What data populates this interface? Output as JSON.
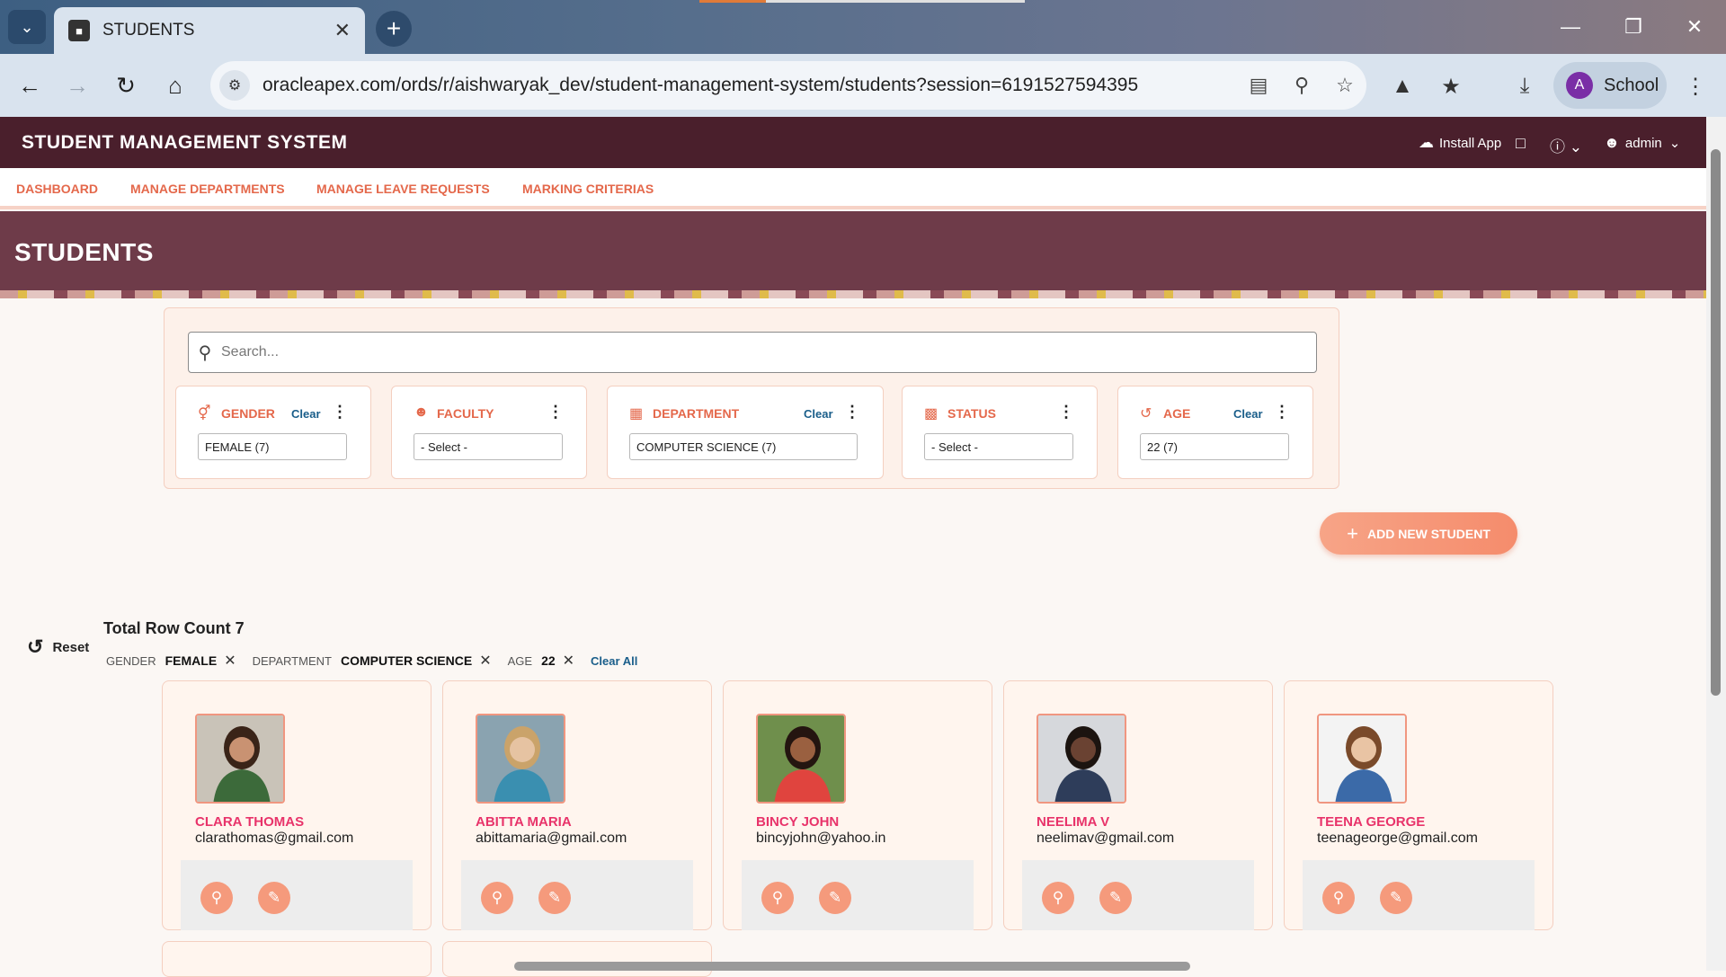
{
  "browser": {
    "tab_title": "STUDENTS",
    "url": "oracleapex.com/ords/r/aishwaryak_dev/student-management-system/students?session=6191527594395",
    "profile_initial": "A",
    "profile_name": "School"
  },
  "app": {
    "name": "STUDENT MANAGEMENT SYSTEM",
    "install_label": "Install App",
    "user_label": "admin"
  },
  "menu": {
    "items": [
      {
        "label": "DASHBOARD"
      },
      {
        "label": "MANAGE DEPARTMENTS"
      },
      {
        "label": "MANAGE LEAVE REQUESTS"
      },
      {
        "label": "MARKING CRITERIAS"
      }
    ]
  },
  "page": {
    "title": "STUDENTS"
  },
  "search": {
    "placeholder": "Search..."
  },
  "facets": [
    {
      "label": "GENDER",
      "clear": "Clear",
      "value": "FEMALE (7)"
    },
    {
      "label": "FACULTY",
      "clear": "",
      "value": "- Select -"
    },
    {
      "label": "DEPARTMENT",
      "clear": "Clear",
      "value": "COMPUTER SCIENCE (7)"
    },
    {
      "label": "STATUS",
      "clear": "",
      "value": "- Select -"
    },
    {
      "label": "AGE",
      "clear": "Clear",
      "value": "22 (7)"
    }
  ],
  "add_button": {
    "label": "ADD NEW STUDENT"
  },
  "results": {
    "reset_label": "Reset",
    "row_count": "Total Row Count 7",
    "chips": [
      {
        "key": "GENDER",
        "value": "FEMALE"
      },
      {
        "key": "DEPARTMENT",
        "value": "COMPUTER SCIENCE"
      },
      {
        "key": "AGE",
        "value": "22"
      }
    ],
    "clear_all": "Clear All"
  },
  "students": [
    {
      "name": "CLARA THOMAS",
      "email": "clarathomas@gmail.com",
      "shirt": "#3c6a3a",
      "bg": "#c9c3b8",
      "skin": "#c99272",
      "hair": "#3a2418"
    },
    {
      "name": "ABITTA MARIA",
      "email": "abittamaria@gmail.com",
      "shirt": "#3a8fb0",
      "bg": "#8aa3b0",
      "skin": "#e6c3a2",
      "hair": "#caa36a"
    },
    {
      "name": "BINCY JOHN",
      "email": "bincyjohn@yahoo.in",
      "shirt": "#e0443e",
      "bg": "#6f8f4c",
      "skin": "#9a6040",
      "hair": "#241510"
    },
    {
      "name": "NEELIMA V",
      "email": "neelimav@gmail.com",
      "shirt": "#2e3d5a",
      "bg": "#d6d8dc",
      "skin": "#6a4232",
      "hair": "#1c1410"
    },
    {
      "name": "TEENA GEORGE",
      "email": "teenageorge@gmail.com",
      "shirt": "#3b6aa8",
      "bg": "#f3f3f3",
      "skin": "#e9c4a4",
      "hair": "#7a4a2a"
    }
  ]
}
